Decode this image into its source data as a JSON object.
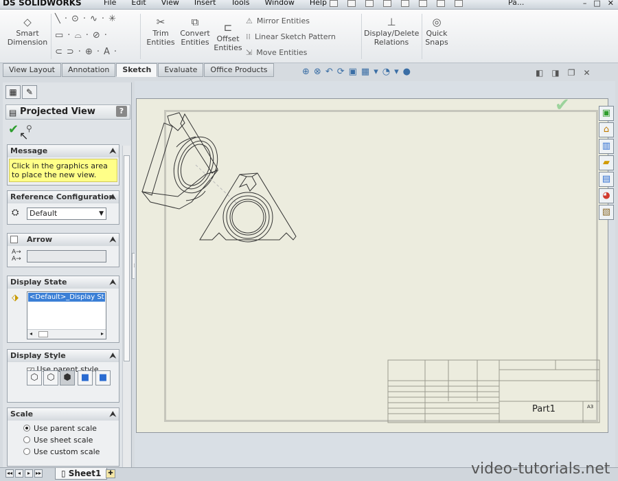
{
  "app": {
    "brand_prefix": "DS",
    "brand_name": "SOLIDWORKS",
    "doc_title": "Pa..."
  },
  "menu": [
    "File",
    "Edit",
    "View",
    "Insert",
    "Tools",
    "Window",
    "Help"
  ],
  "ribbon": {
    "smart_dimension": "Smart Dimension",
    "trim_entities": "Trim Entities",
    "convert_entities": "Convert Entities",
    "offset_entities": "Offset Entities",
    "mirror_entities": "Mirror Entities",
    "linear_sketch_pattern": "Linear Sketch Pattern",
    "move_entities": "Move Entities",
    "display_delete_relations": "Display/Delete Relations",
    "quick_snaps": "Quick Snaps"
  },
  "tabs": [
    {
      "label": "View Layout"
    },
    {
      "label": "Annotation"
    },
    {
      "label": "Sketch",
      "active": true
    },
    {
      "label": "Evaluate"
    },
    {
      "label": "Office Products"
    }
  ],
  "property_manager": {
    "title": "Projected View",
    "help": "?",
    "message": {
      "header": "Message",
      "text": "Click in the graphics area to place the new view."
    },
    "reference_configuration": {
      "header": "Reference Configuration",
      "value": "Default"
    },
    "arrow": {
      "header": "Arrow",
      "label_field_value": ""
    },
    "display_state": {
      "header": "Display State",
      "item": "<Default>_Display St"
    },
    "display_style": {
      "header": "Display Style",
      "use_parent_style": "Use parent style",
      "checked": true
    },
    "scale": {
      "header": "Scale",
      "options": [
        "Use parent scale",
        "Use sheet scale",
        "Use custom scale"
      ],
      "selected": 0
    }
  },
  "drawing": {
    "part_name": "Part1",
    "size": "A3"
  },
  "sheet_tab": "Sheet1",
  "watermark": "video-tutorials.net",
  "colors": {
    "accent": "#c1121f",
    "message_bg": "#ffff88",
    "sheet_bg": "#ececde",
    "ok_green": "#2e9e2e"
  }
}
